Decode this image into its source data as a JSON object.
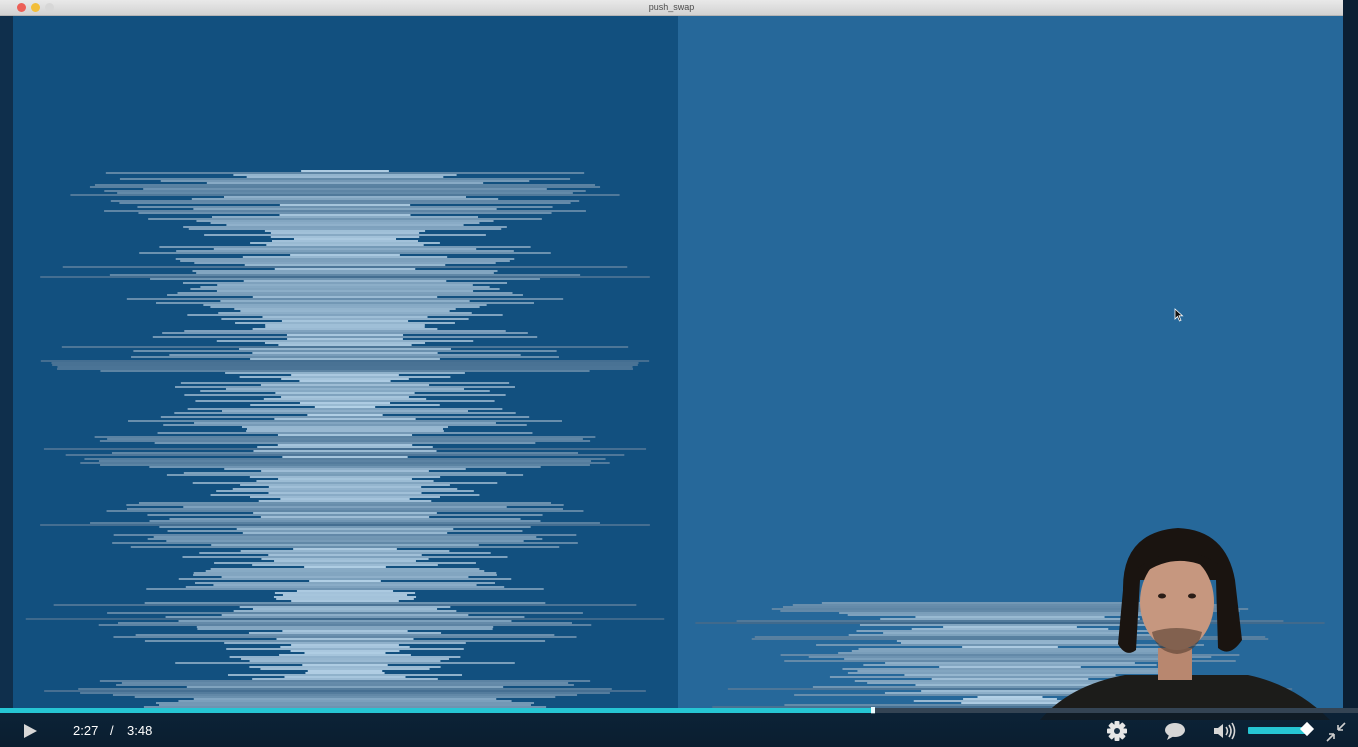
{
  "window": {
    "title": "push_swap"
  },
  "player": {
    "current_time": "2:27",
    "separator": "/",
    "duration": "3:48",
    "progress_fraction": 0.643,
    "volume_fraction": 0.87,
    "icons": {
      "play": "play-icon",
      "settings": "gear-icon",
      "captions": "speech-bubble-icon",
      "volume": "speaker-icon",
      "fullscreen": "exit-fullscreen-icon"
    }
  },
  "colors": {
    "accent": "#26c6d4",
    "stack_a_bg": "#12507f",
    "stack_b_bg": "#26689a",
    "bar_light": "#c9e4f7",
    "bar_dark": "#0d3d66"
  }
}
